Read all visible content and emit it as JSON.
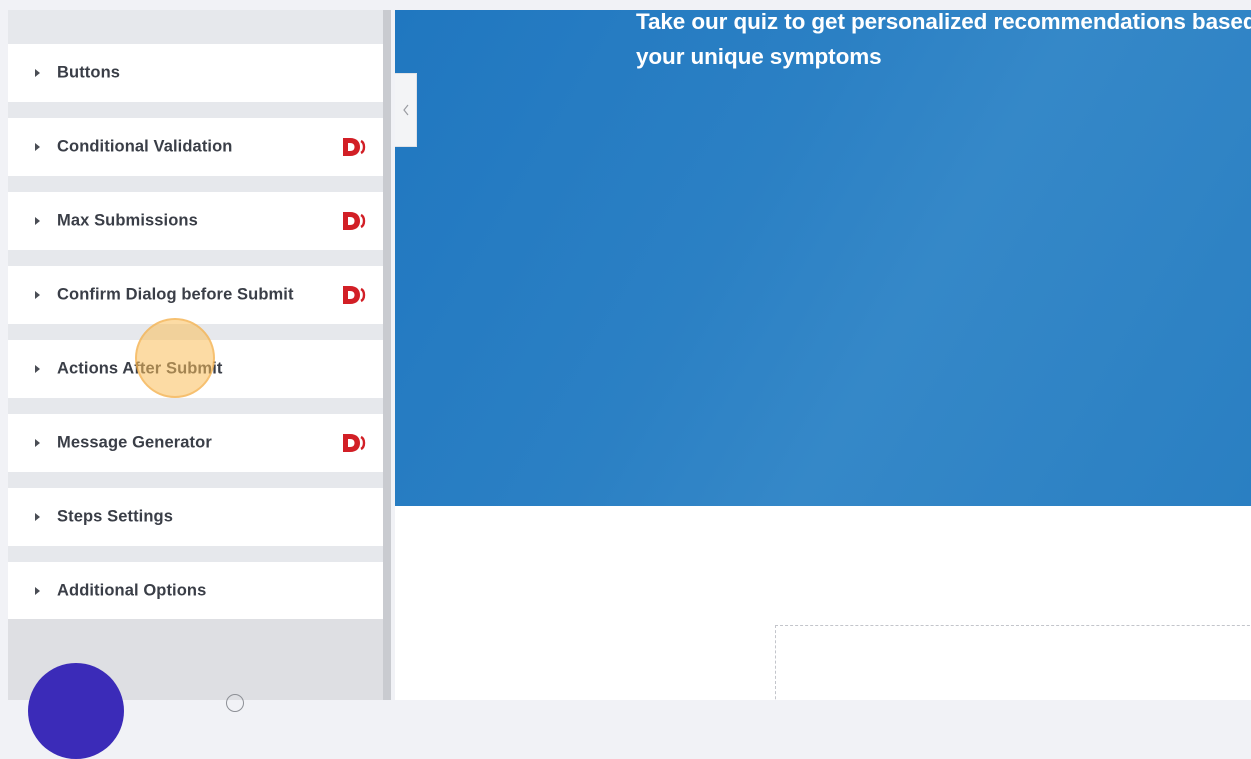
{
  "sidebar": {
    "sections": [
      {
        "label": "Buttons",
        "pro": false
      },
      {
        "label": "Conditional Validation",
        "pro": true
      },
      {
        "label": "Max Submissions",
        "pro": true
      },
      {
        "label": "Confirm Dialog before Submit",
        "pro": true
      },
      {
        "label": "Actions After Submit",
        "pro": false
      },
      {
        "label": "Message Generator",
        "pro": true
      },
      {
        "label": "Steps Settings",
        "pro": false
      },
      {
        "label": "Additional Options",
        "pro": false
      }
    ],
    "pro_badge": {
      "icon": "dynamic-pro-badge-icon",
      "color": "#d21f26"
    },
    "footer": {
      "avatar_color": "#3b2bb8"
    }
  },
  "canvas": {
    "hero": {
      "text": "Take our quiz to get personalized recommendations based on your unique symptoms",
      "background": "#2a7fc2"
    }
  },
  "collapse_toggle": {
    "icon": "chevron-left-icon"
  }
}
